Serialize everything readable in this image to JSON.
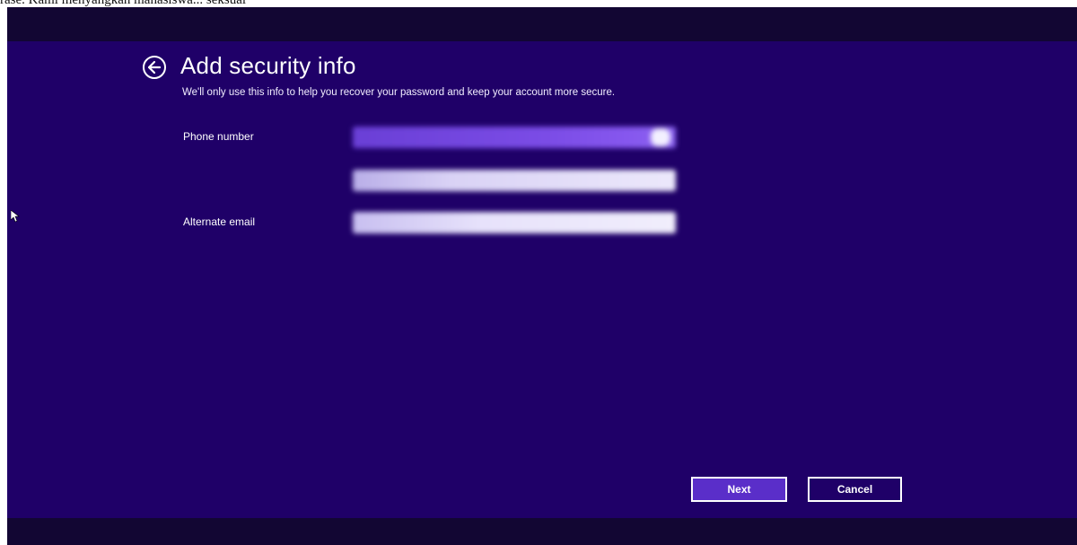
{
  "caption": "rase. Kami menyangkan mahasiswa... seksual",
  "header": {
    "title": "Add security info",
    "back_icon": "back-arrow-circle-icon"
  },
  "description": "We'll only use this info to help you recover your password and keep your account more secure.",
  "form": {
    "phone_label": "Phone number",
    "alternate_email_label": "Alternate email"
  },
  "buttons": {
    "next_label": "Next",
    "cancel_label": "Cancel"
  },
  "colors": {
    "background": "#1f0068",
    "bars": "#120633",
    "accent": "#5a2ec9",
    "text": "#ffffff"
  }
}
